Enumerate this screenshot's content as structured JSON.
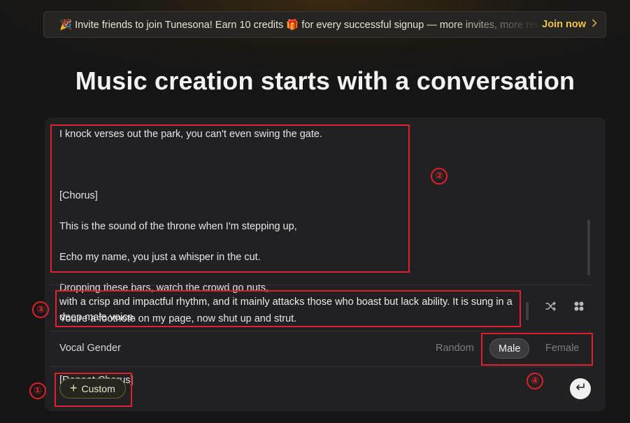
{
  "banner": {
    "text": "🎉 Invite friends to join Tunesona! Earn 10 credits 🎁 for every successful signup — more invites, more rewards!",
    "cta": "Join now",
    "cta_icon": "chevron-right-icon"
  },
  "headline": "Music creation starts with a conversation",
  "lyrics": {
    "partial_line": "I knock verses out the park, you can't even swing the gate.",
    "lines": [
      "",
      "[Chorus]",
      "This is the sound of the throne when I'm stepping up,",
      "Echo my name, you just a whisper in the cut.",
      "Dropping these bars, watch the crowd go nuts,",
      "You're a footnote on my page, now shut up and strut.",
      "",
      "[Repeat Chorus]"
    ]
  },
  "description": {
    "text": "with a crisp and impactful rhythm, and it mainly attacks those who boast but lack ability. It is sung in a deep male voice."
  },
  "icons": {
    "shuffle": "shuffle-icon",
    "style": "style-grid-icon",
    "send": "enter-return-icon"
  },
  "vocal": {
    "label": "Vocal Gender",
    "options": [
      "Random",
      "Male",
      "Female"
    ],
    "selected": "Male"
  },
  "custom_button": {
    "label": "Custom"
  },
  "annotations": [
    "①",
    "②",
    "③",
    "④"
  ],
  "colors": {
    "accent_gold": "#f0c34a",
    "annotation_red": "#e0202a"
  }
}
